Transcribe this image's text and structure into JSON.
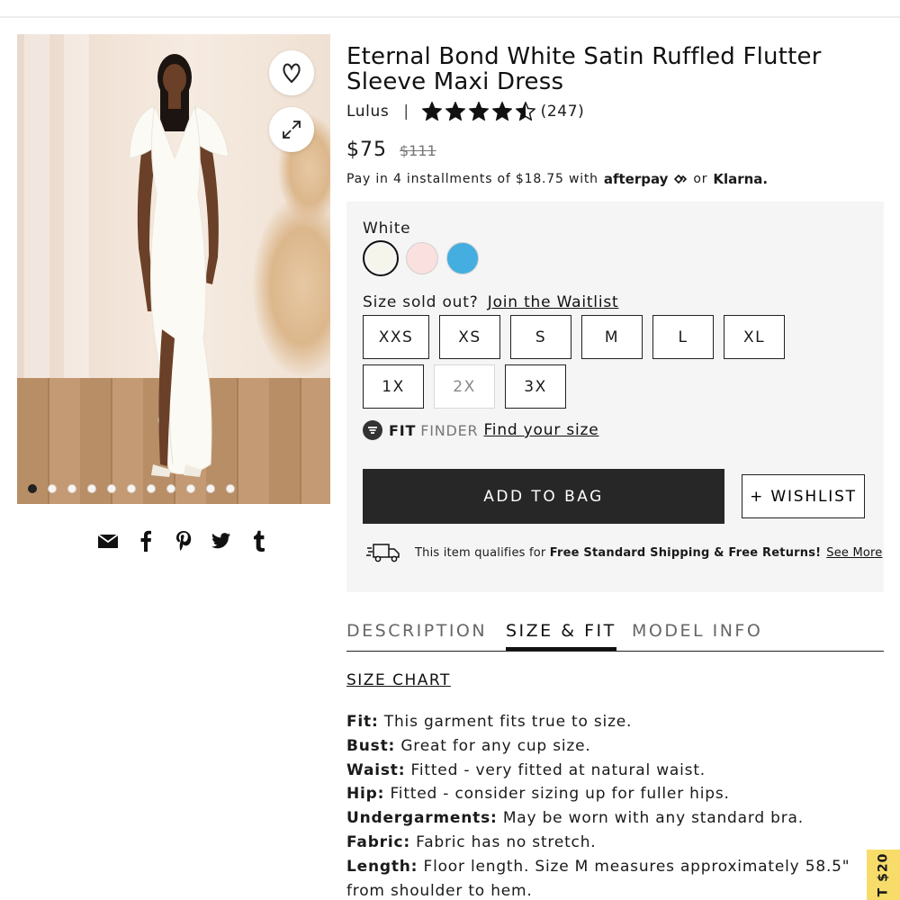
{
  "product": {
    "title": "Eternal Bond White Satin Ruffled Flutter Sleeve Maxi Dress",
    "brand": "Lulus",
    "separator": "|",
    "rating": 4.5,
    "rating_max": 5,
    "review_count": "(247)",
    "price_now": "$75",
    "price_was": "$111"
  },
  "payment": {
    "text": "Pay in 4 installments of $18.75 with",
    "afterpay": "afterpay",
    "or": "or",
    "klarna": "Klarna."
  },
  "gallery": {
    "image_count": 11,
    "active_index": 0,
    "icons": {
      "favorite": "heart-icon",
      "expand": "expand-icon"
    }
  },
  "share": {
    "icons": [
      "email-icon",
      "facebook-icon",
      "pinterest-icon",
      "twitter-icon",
      "tumblr-icon"
    ]
  },
  "colors": {
    "selected_label": "White",
    "swatches": [
      {
        "name": "White",
        "hex": "#f6f5ec",
        "selected": true
      },
      {
        "name": "Blush",
        "hex": "#fbe0e0",
        "selected": false
      },
      {
        "name": "Blue",
        "hex": "#44aee0",
        "selected": false
      }
    ]
  },
  "sizes": {
    "sold_out_text": "Size sold out?",
    "waitlist_link": "Join the Waitlist",
    "options": [
      {
        "label": "XXS",
        "available": true
      },
      {
        "label": "XS",
        "available": true
      },
      {
        "label": "S",
        "available": true
      },
      {
        "label": "M",
        "available": true
      },
      {
        "label": "L",
        "available": true
      },
      {
        "label": "XL",
        "available": true
      },
      {
        "label": "1X",
        "available": true
      },
      {
        "label": "2X",
        "available": false
      },
      {
        "label": "3X",
        "available": true
      }
    ]
  },
  "fit_finder": {
    "fit": "FIT",
    "finder": "FINDER",
    "link": "Find your size"
  },
  "actions": {
    "add_to_bag": "ADD TO BAG",
    "wishlist": "+ WISHLIST"
  },
  "shipping": {
    "prefix": "This item qualifies for",
    "bold": "Free Standard Shipping & Free Returns!",
    "link": "See More"
  },
  "tabs": [
    {
      "label": "DESCRIPTION",
      "active": false
    },
    {
      "label": "SIZE & FIT",
      "active": true
    },
    {
      "label": "MODEL INFO",
      "active": false
    }
  ],
  "size_fit": {
    "chart_link": "SIZE CHART",
    "items": [
      {
        "label": "Fit:",
        "text": "This garment fits true to size."
      },
      {
        "label": "Bust:",
        "text": "Great for any cup size."
      },
      {
        "label": "Waist:",
        "text": "Fitted - very fitted at natural waist."
      },
      {
        "label": "Hip:",
        "text": "Fitted - consider sizing up for fuller hips."
      },
      {
        "label": "Undergarments:",
        "text": "May be worn with any standard bra."
      },
      {
        "label": "Fabric:",
        "text": "Fabric has no stretch."
      },
      {
        "label": "Length:",
        "text": "Floor length. Size M measures approximately 58.5\" from shoulder to hem."
      }
    ]
  },
  "promo_tab": {
    "label": "T $20"
  }
}
